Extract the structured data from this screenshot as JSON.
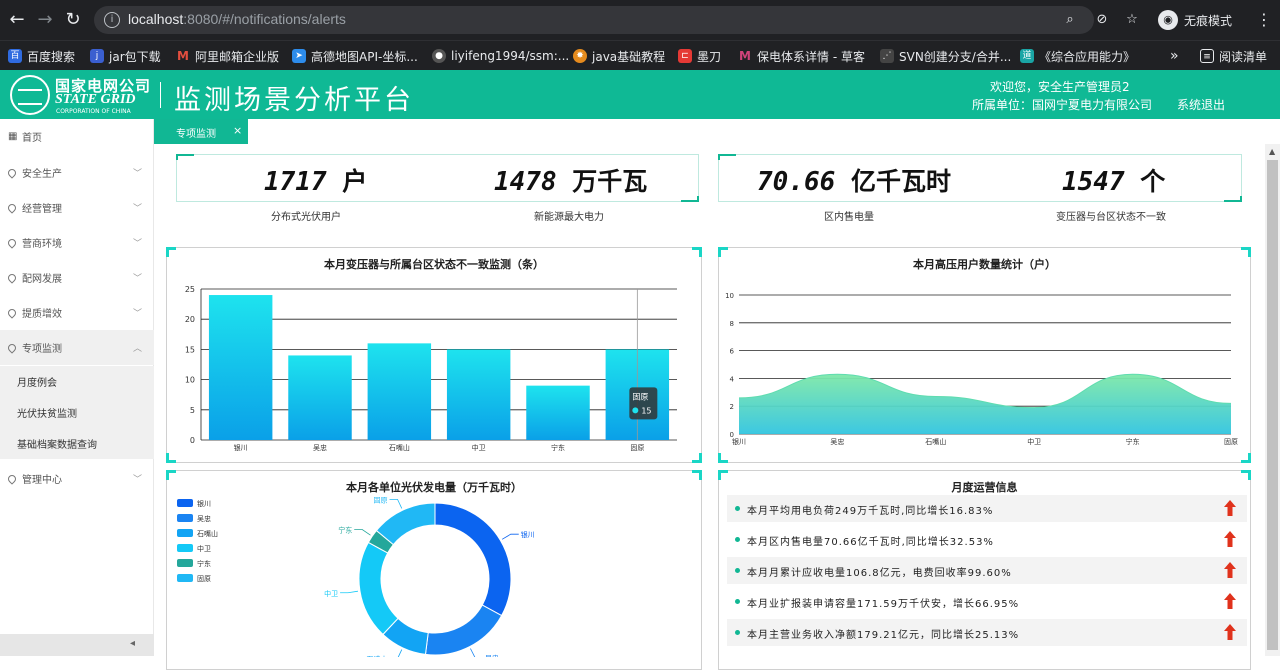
{
  "browser": {
    "url_host": "localhost",
    "url_rest": ":8080/#/notifications/alerts",
    "incognito_label": "无痕模式"
  },
  "bookmarks": [
    {
      "label": "百度搜索",
      "color": "#2f6be0"
    },
    {
      "label": "jar包下载",
      "color": "#3a5fd0"
    },
    {
      "label": "阿里邮箱企业版",
      "color": "#e34e3f"
    },
    {
      "label": "高德地图API-坐标...",
      "color": "#2d8ceb"
    },
    {
      "label": "liyifeng1994/ssm:...",
      "color": "#555555"
    },
    {
      "label": "java基础教程",
      "color": "#e58b1e"
    },
    {
      "label": "墨刀",
      "color": "#e53935"
    },
    {
      "label": "保电体系详情 - 草客",
      "color": "#d0437a"
    },
    {
      "label": "SVN创建分支/合并...",
      "color": "#444444"
    },
    {
      "label": "《综合应用能力》",
      "color": "#1aa5a5"
    }
  ],
  "bookmarks_more": "»",
  "reading_list": "阅读清单",
  "header": {
    "logo_cn": "国家电网公司",
    "logo_en": "STATE GRID",
    "logo_en_sub": "CORPORATION OF CHINA",
    "title": "监测场景分析平台",
    "welcome": "欢迎您，安全生产管理员2",
    "unit": "所属单位：国网宁夏电力有限公司",
    "logout": "系统退出"
  },
  "sidebar": {
    "items": [
      {
        "label": "首页"
      },
      {
        "label": "安全生产"
      },
      {
        "label": "经营管理"
      },
      {
        "label": "营商环境"
      },
      {
        "label": "配网发展"
      },
      {
        "label": "提质增效"
      },
      {
        "label": "专项监测"
      }
    ],
    "sub_items": [
      {
        "label": "月度例会"
      },
      {
        "label": "光伏扶贫监测"
      },
      {
        "label": "基础档案数据查询"
      }
    ],
    "last_item": {
      "label": "管理中心"
    },
    "collapse_icon": "◂"
  },
  "tab": {
    "label": "专项监测",
    "close": "×"
  },
  "kpis": [
    {
      "value": "1717",
      "unit": "户",
      "label": "分布式光伏用户"
    },
    {
      "value": "1478",
      "unit": "万千瓦",
      "label": "新能源最大电力"
    },
    {
      "value": "70.66",
      "unit": "亿千瓦时",
      "label": "区内售电量"
    },
    {
      "value": "1547",
      "unit": "个",
      "label": "变压器与台区状态不一致"
    }
  ],
  "bar_panel": {
    "title": "本月变压器与所属台区状态不一致监测（条）"
  },
  "area_panel": {
    "title": "本月高压用户数量统计（户）"
  },
  "donut_panel": {
    "title": "本月各单位光伏发电量（万千瓦时）"
  },
  "ops_panel": {
    "title": "月度运营信息",
    "rows": [
      {
        "text": "本月平均用电负荷249万千瓦时,同比增长16.83%"
      },
      {
        "text": "本月区内售电量70.66亿千瓦时,同比增长32.53%"
      },
      {
        "text": "本月月累计应收电量106.8亿元，电费回收率99.60%"
      },
      {
        "text": "本月业扩报装申请容量171.59万千伏安，增长66.95%"
      },
      {
        "text": "本月主营业务收入净额179.21亿元，同比增长25.13%"
      }
    ]
  },
  "chart_data": [
    {
      "type": "bar",
      "title": "本月变压器与所属台区状态不一致监测（条）",
      "categories": [
        "银川",
        "吴忠",
        "石嘴山",
        "中卫",
        "宁东",
        "固原"
      ],
      "values": [
        24,
        14,
        16,
        15,
        9,
        15
      ],
      "ylim": [
        0,
        25
      ],
      "yticks": [
        0,
        5,
        10,
        15,
        20,
        25
      ],
      "grid": true,
      "tooltip": {
        "category": "固原",
        "value": 15
      },
      "colors": {
        "top": "#1ee3ee",
        "bottom": "#0aa0e8"
      }
    },
    {
      "type": "area",
      "title": "本月高压用户数量统计（户）",
      "categories": [
        "银川",
        "吴忠",
        "石嘴山",
        "中卫",
        "宁东",
        "固原"
      ],
      "values": [
        2.6,
        4.3,
        2.7,
        1.9,
        4.3,
        2.2
      ],
      "ylim": [
        0,
        10
      ],
      "yticks": [
        0,
        2,
        4,
        6,
        8,
        10
      ],
      "grid": true,
      "colors": {
        "top": "#7ee8a8",
        "bottom": "#32c5e0"
      }
    },
    {
      "type": "pie",
      "title": "本月各单位光伏发电量（万千瓦时）",
      "donut": true,
      "legend": "top-left",
      "slices": [
        {
          "name": "银川",
          "value": 33,
          "color": "#0b64f0"
        },
        {
          "name": "吴忠",
          "value": 19,
          "color": "#1a84f2"
        },
        {
          "name": "石嘴山",
          "value": 10,
          "color": "#12a4f4"
        },
        {
          "name": "中卫",
          "value": 21,
          "color": "#14c9f7"
        },
        {
          "name": "宁东",
          "value": 3,
          "color": "#24a79b"
        },
        {
          "name": "固原",
          "value": 14,
          "color": "#20b8f5"
        }
      ]
    }
  ]
}
